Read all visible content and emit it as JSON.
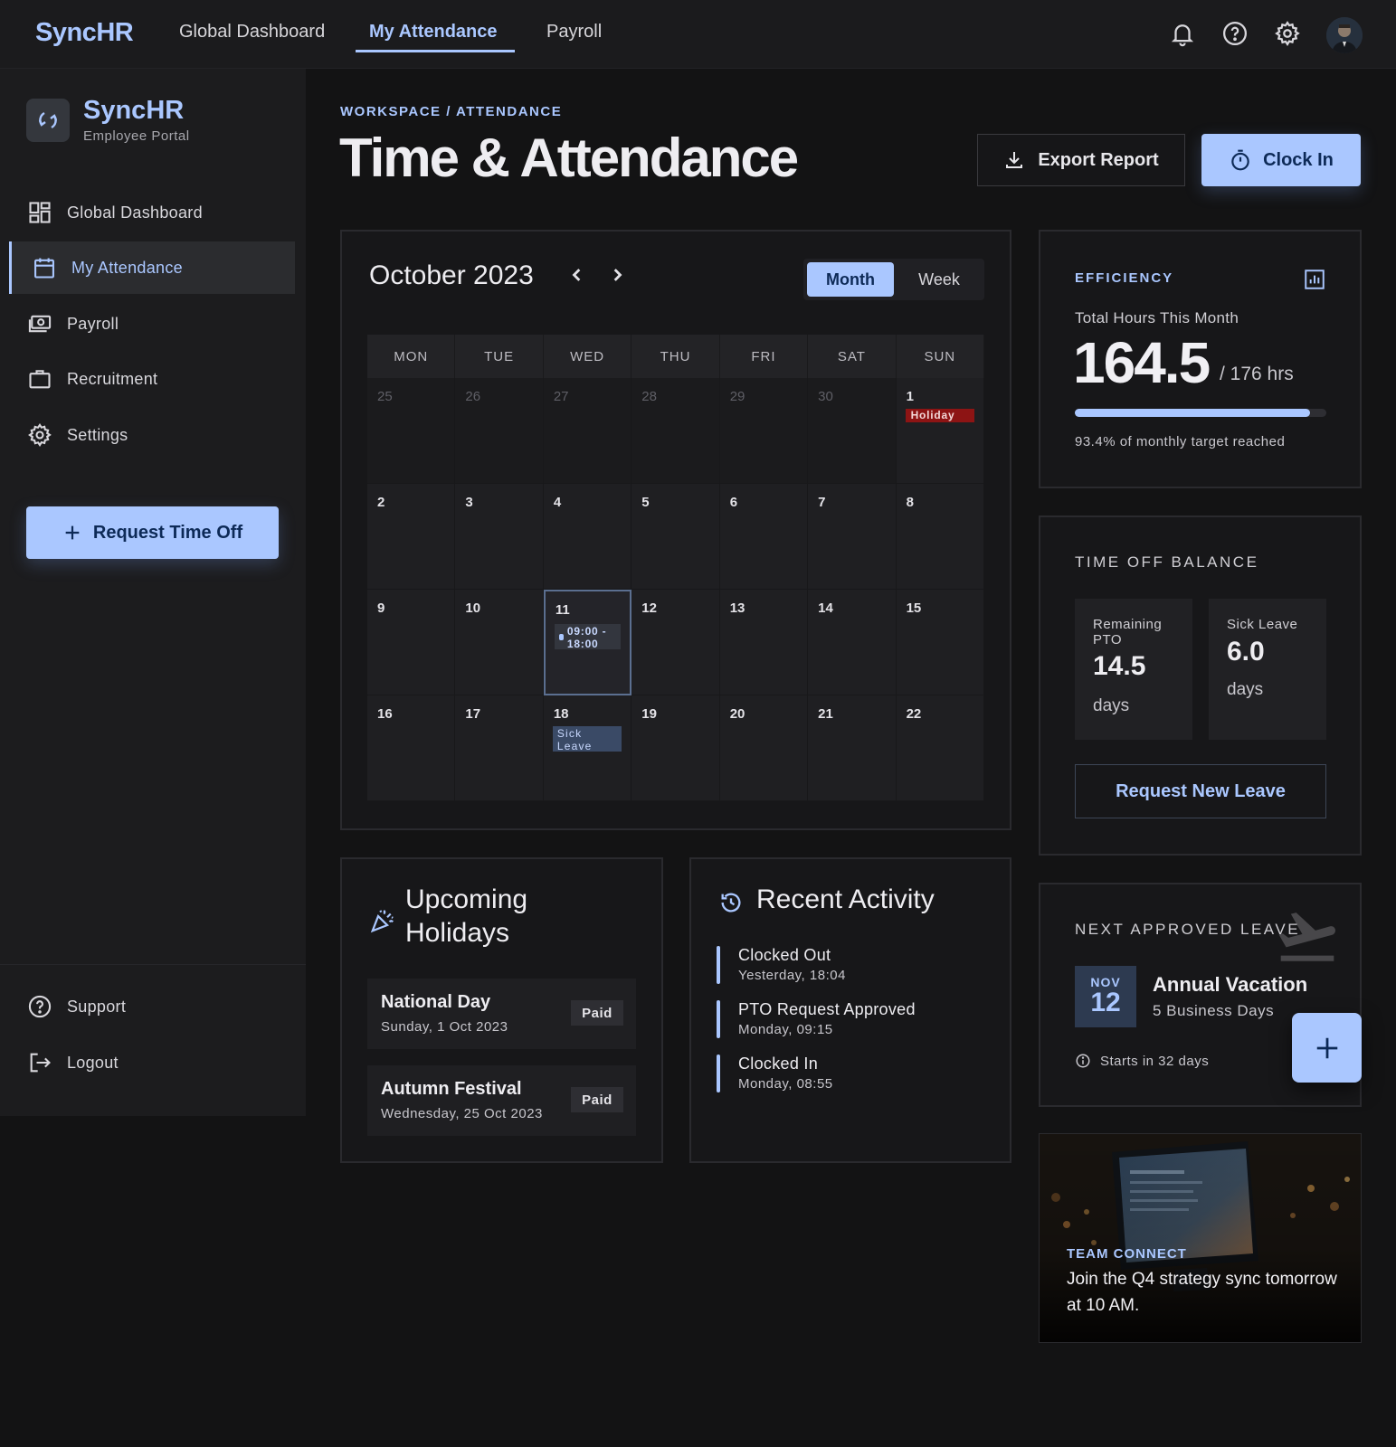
{
  "topbar": {
    "brand": "SyncHR",
    "nav": [
      "Global Dashboard",
      "My Attendance",
      "Payroll"
    ],
    "active_nav": "My Attendance",
    "icons": [
      "bell-icon",
      "help-icon",
      "gear-icon"
    ]
  },
  "sidebar": {
    "title": "SyncHR",
    "subtitle": "Employee Portal",
    "items": [
      {
        "label": "Global Dashboard",
        "icon": "dashboard-icon"
      },
      {
        "label": "My Attendance",
        "icon": "calendar-icon",
        "active": true
      },
      {
        "label": "Payroll",
        "icon": "payments-icon"
      },
      {
        "label": "Recruitment",
        "icon": "briefcase-icon"
      },
      {
        "label": "Settings",
        "icon": "gear-icon"
      }
    ],
    "cta": "Request Time Off",
    "footer": [
      {
        "label": "Support",
        "icon": "help-icon"
      },
      {
        "label": "Logout",
        "icon": "logout-icon"
      }
    ]
  },
  "header": {
    "breadcrumb": "WORKSPACE / ATTENDANCE",
    "title": "Time & Attendance",
    "export_label": "Export Report",
    "clock_in_label": "Clock In"
  },
  "calendar": {
    "month_label": "October 2023",
    "views": [
      "Month",
      "Week"
    ],
    "active_view": "Month",
    "weekdays": [
      "MON",
      "TUE",
      "WED",
      "THU",
      "FRI",
      "SAT",
      "SUN"
    ],
    "weeks": [
      [
        {
          "d": "25",
          "muted": true
        },
        {
          "d": "26",
          "muted": true
        },
        {
          "d": "27",
          "muted": true
        },
        {
          "d": "28",
          "muted": true
        },
        {
          "d": "29",
          "muted": true
        },
        {
          "d": "30",
          "muted": true
        },
        {
          "d": "1",
          "tag": "Holiday",
          "tag_type": "holiday"
        }
      ],
      [
        {
          "d": "2"
        },
        {
          "d": "3"
        },
        {
          "d": "4"
        },
        {
          "d": "5"
        },
        {
          "d": "6"
        },
        {
          "d": "7"
        },
        {
          "d": "8"
        }
      ],
      [
        {
          "d": "9"
        },
        {
          "d": "10"
        },
        {
          "d": "11",
          "today": true,
          "tag": "09:00 - 18:00",
          "tag_type": "shift"
        },
        {
          "d": "12"
        },
        {
          "d": "13"
        },
        {
          "d": "14"
        },
        {
          "d": "15"
        }
      ],
      [
        {
          "d": "16"
        },
        {
          "d": "17"
        },
        {
          "d": "18",
          "tag": "Sick Leave",
          "tag_type": "sick"
        },
        {
          "d": "19"
        },
        {
          "d": "20"
        },
        {
          "d": "21"
        },
        {
          "d": "22"
        }
      ]
    ]
  },
  "efficiency": {
    "label": "EFFICIENCY",
    "subtitle": "Total Hours This Month",
    "hours": "164.5",
    "target": "/ 176 hrs",
    "progress": 0.935,
    "footnote": "93.4% of monthly target reached"
  },
  "time_off": {
    "label": "TIME OFF BALANCE",
    "remaining_label": "Remaining PTO",
    "remaining_value": "14.5",
    "remaining_unit": "days",
    "sick_label": "Sick Leave",
    "sick_value": "6.0",
    "sick_unit": "days",
    "button": "Request New Leave"
  },
  "next_leave": {
    "label": "NEXT APPROVED LEAVE",
    "month": "NOV",
    "day": "12",
    "title": "Annual Vacation",
    "subtitle": "5 Business Days",
    "footnote": "Starts in 32 days"
  },
  "team_connect": {
    "label": "TEAM CONNECT",
    "text": "Join the Q4 strategy sync tomorrow at 10 AM."
  },
  "holidays": {
    "title": "Upcoming Holidays",
    "items": [
      {
        "name": "National Day",
        "date": "Sunday, 1 Oct 2023",
        "badge": "Paid"
      },
      {
        "name": "Autumn Festival",
        "date": "Wednesday, 25 Oct 2023",
        "badge": "Paid"
      }
    ]
  },
  "activity": {
    "title": "Recent Activity",
    "items": [
      {
        "title": "Clocked Out",
        "time": "Yesterday, 18:04"
      },
      {
        "title": "PTO Request Approved",
        "time": "Monday, 09:15"
      },
      {
        "title": "Clocked In",
        "time": "Monday, 08:55"
      }
    ]
  },
  "colors": {
    "accent": "#aac7ff",
    "holiday": "#8d1414",
    "background": "#131314"
  }
}
